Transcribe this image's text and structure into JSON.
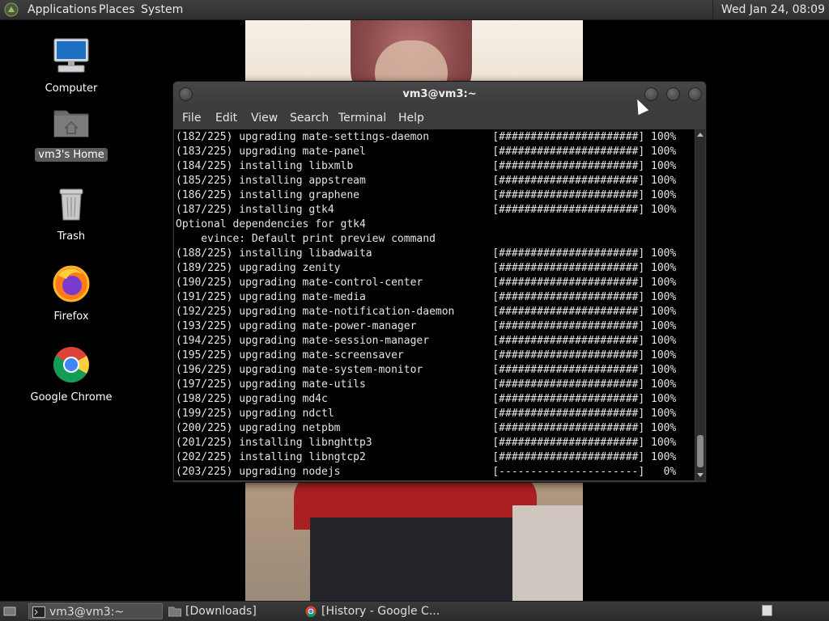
{
  "top_panel": {
    "menus": [
      "Applications",
      "Places",
      "System"
    ],
    "clock": "Wed Jan 24, 08:09"
  },
  "desktop_icons": [
    {
      "label": "Computer",
      "icon": "computer-icon"
    },
    {
      "label": "vm3's Home",
      "icon": "home-folder-icon",
      "selected": true
    },
    {
      "label": "Trash",
      "icon": "trash-icon"
    },
    {
      "label": "Firefox",
      "icon": "firefox-icon"
    },
    {
      "label": "Google Chrome",
      "icon": "chrome-icon"
    }
  ],
  "terminal": {
    "title": "vm3@vm3:~",
    "menu": [
      "File",
      "Edit",
      "View",
      "Search",
      "Terminal",
      "Help"
    ],
    "lines": [
      "(182/225) upgrading mate-settings-daemon          [######################] 100%",
      "(183/225) upgrading mate-panel                    [######################] 100%",
      "(184/225) installing libxmlb                      [######################] 100%",
      "(185/225) installing appstream                    [######################] 100%",
      "(186/225) installing graphene                     [######################] 100%",
      "(187/225) installing gtk4                         [######################] 100%",
      "Optional dependencies for gtk4",
      "    evince: Default print preview command",
      "(188/225) installing libadwaita                   [######################] 100%",
      "(189/225) upgrading zenity                        [######################] 100%",
      "(190/225) upgrading mate-control-center           [######################] 100%",
      "(191/225) upgrading mate-media                    [######################] 100%",
      "(192/225) upgrading mate-notification-daemon      [######################] 100%",
      "(193/225) upgrading mate-power-manager            [######################] 100%",
      "(194/225) upgrading mate-session-manager          [######################] 100%",
      "(195/225) upgrading mate-screensaver              [######################] 100%",
      "(196/225) upgrading mate-system-monitor           [######################] 100%",
      "(197/225) upgrading mate-utils                    [######################] 100%",
      "(198/225) upgrading md4c                          [######################] 100%",
      "(199/225) upgrading ndctl                         [######################] 100%",
      "(200/225) upgrading netpbm                        [######################] 100%",
      "(201/225) installing libnghttp3                   [######################] 100%",
      "(202/225) installing libngtcp2                    [######################] 100%",
      "(203/225) upgrading nodejs                        [----------------------]   0%"
    ]
  },
  "taskbar": {
    "tasks": [
      {
        "label": "vm3@vm3:~",
        "icon": "terminal-icon",
        "active": true
      },
      {
        "label": "[Downloads]",
        "icon": "folder-icon",
        "active": false
      },
      {
        "label": "[History - Google C...",
        "icon": "chrome-icon",
        "active": false
      }
    ]
  }
}
